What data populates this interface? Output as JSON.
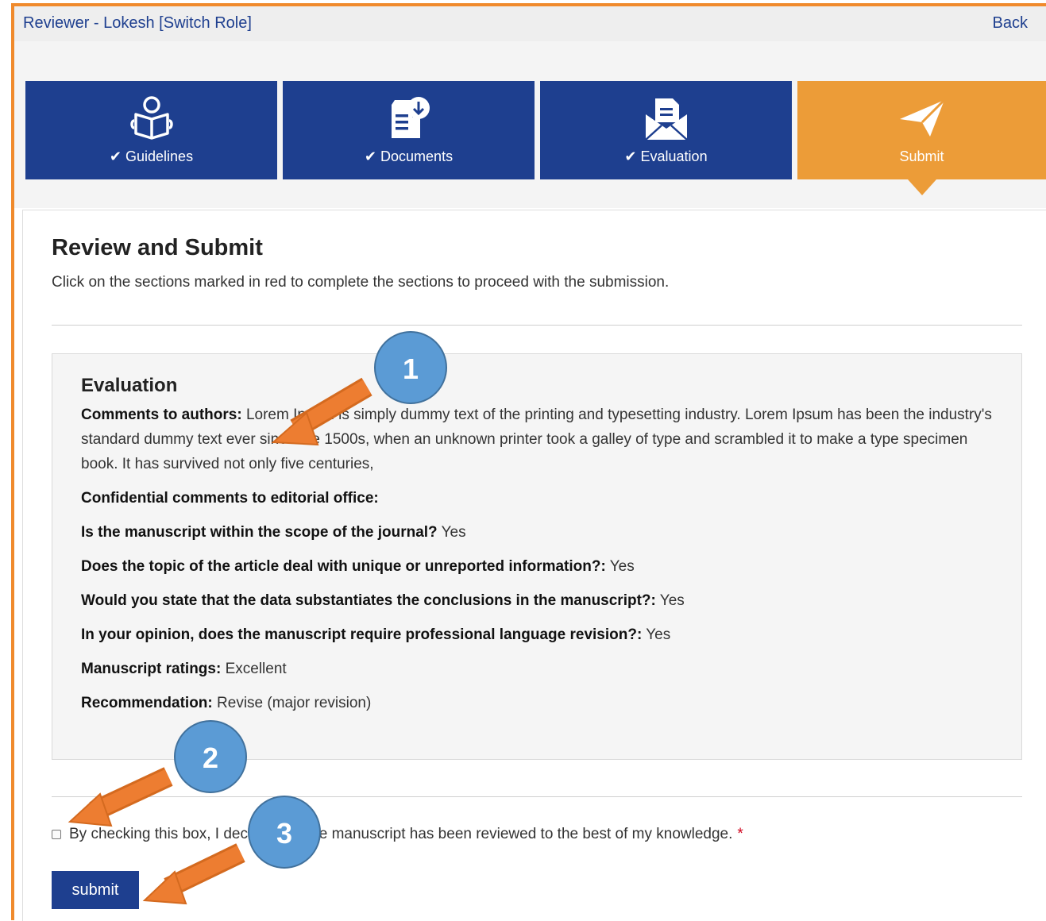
{
  "topbar": {
    "role_label": "Reviewer - Lokesh [Switch Role]",
    "back_label": "Back"
  },
  "steps": [
    {
      "label": "Guidelines",
      "checked": true,
      "icon": "reading-person-icon"
    },
    {
      "label": "Documents",
      "checked": true,
      "icon": "document-download-icon"
    },
    {
      "label": "Evaluation",
      "checked": true,
      "icon": "envelope-document-icon"
    },
    {
      "label": "Submit",
      "checked": false,
      "icon": "paper-plane-icon",
      "active": true
    }
  ],
  "check_glyph": "✔",
  "page": {
    "title": "Review and Submit",
    "intro": "Click on the sections marked in red to complete the sections to proceed with the submission."
  },
  "evaluation": {
    "heading": "Evaluation",
    "rows": [
      {
        "label": "Comments to authors:",
        "value": " Lorem Ipsum is simply dummy text of the printing and typesetting industry. Lorem Ipsum has been the industry's standard dummy text ever since the 1500s, when an unknown printer took a galley of type and scrambled it to make a type specimen book. It has survived not only five centuries,"
      },
      {
        "label": "Confidential comments to editorial office:",
        "value": ""
      },
      {
        "label": "Is the manuscript within the scope of the journal?",
        "value": " Yes"
      },
      {
        "label": "Does the topic of the article deal with unique or unreported information?:",
        "value": " Yes"
      },
      {
        "label": "Would you state that the data substantiates the conclusions in the manuscript?:",
        "value": " Yes"
      },
      {
        "label": "In your opinion, does the manuscript require professional language revision?:",
        "value": " Yes"
      },
      {
        "label": "Manuscript ratings:",
        "value": " Excellent"
      },
      {
        "label": "Recommendation:",
        "value": " Revise (major revision)"
      }
    ]
  },
  "consent": {
    "text": "By checking this box, I declare that the manuscript has been reviewed to the best of my knowledge.",
    "required_mark": "*",
    "checked": false
  },
  "submit_label": "submit",
  "annotations": {
    "markers": [
      "1",
      "2",
      "3"
    ],
    "arrow_color": "#ed7d31",
    "marker_color": "#5b9bd5"
  },
  "colors": {
    "primary": "#1e3f8f",
    "accent": "#ec9c38",
    "required": "#d0021b"
  }
}
